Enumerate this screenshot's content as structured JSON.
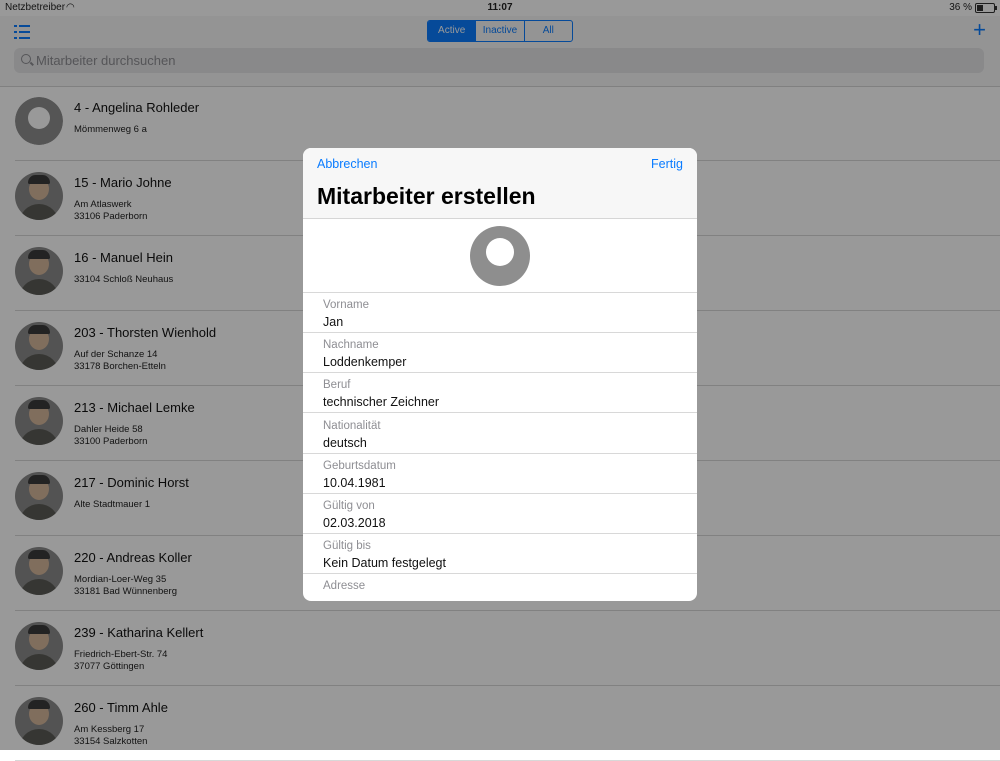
{
  "status": {
    "carrier": "Netzbetreiber",
    "time": "11:07",
    "battery": "36 %",
    "battery_level": 0.36
  },
  "nav": {
    "segments": [
      "Active",
      "Inactive",
      "All"
    ],
    "selected": "Active",
    "search_placeholder": "Mitarbeiter durchsuchen"
  },
  "employees": [
    {
      "name": "4 - Angelina Rohleder",
      "line1": "Mömmenweg 6 a",
      "line2": "",
      "photo": false
    },
    {
      "name": "15 - Mario Johne",
      "line1": "Am Atlaswerk",
      "line2": "33106 Paderborn",
      "photo": true
    },
    {
      "name": "16 - Manuel Hein",
      "line1": "33104 Schloß Neuhaus",
      "line2": "",
      "photo": true
    },
    {
      "name": "203 - Thorsten Wienhold",
      "line1": "Auf der Schanze 14",
      "line2": "33178 Borchen-Etteln",
      "photo": true
    },
    {
      "name": "213 - Michael Lemke",
      "line1": "Dahler Heide 58",
      "line2": "33100 Paderborn",
      "photo": true
    },
    {
      "name": "217 - Dominic Horst",
      "line1": "Alte Stadtmauer 1",
      "line2": "",
      "photo": true
    },
    {
      "name": "220 - Andreas Koller",
      "line1": "Mordian-Loer-Weg 35",
      "line2": "33181 Bad Wünnenberg",
      "photo": true
    },
    {
      "name": "239 - Katharina Kellert",
      "line1": "Friedrich-Ebert-Str. 74",
      "line2": "37077 Göttingen",
      "photo": true
    },
    {
      "name": "260 - Timm Ahle",
      "line1": "Am Kessberg 17",
      "line2": "33154 Salzkotten",
      "photo": true
    }
  ],
  "modal": {
    "cancel": "Abbrechen",
    "done": "Fertig",
    "title": "Mitarbeiter erstellen",
    "fields": [
      {
        "label": "Vorname",
        "value": "Jan"
      },
      {
        "label": "Nachname",
        "value": "Loddenkemper"
      },
      {
        "label": "Beruf",
        "value": "technischer Zeichner"
      },
      {
        "label": "Nationalität",
        "value": "deutsch"
      },
      {
        "label": "Geburtsdatum",
        "value": "10.04.1981"
      },
      {
        "label": "Gültig von",
        "value": "02.03.2018"
      },
      {
        "label": "Gültig bis",
        "value": "Kein Datum festgelegt"
      },
      {
        "label": "Adresse",
        "value": ""
      }
    ]
  },
  "colors": {
    "accent": "#0a7cff",
    "label_gray": "#8e8e93"
  }
}
